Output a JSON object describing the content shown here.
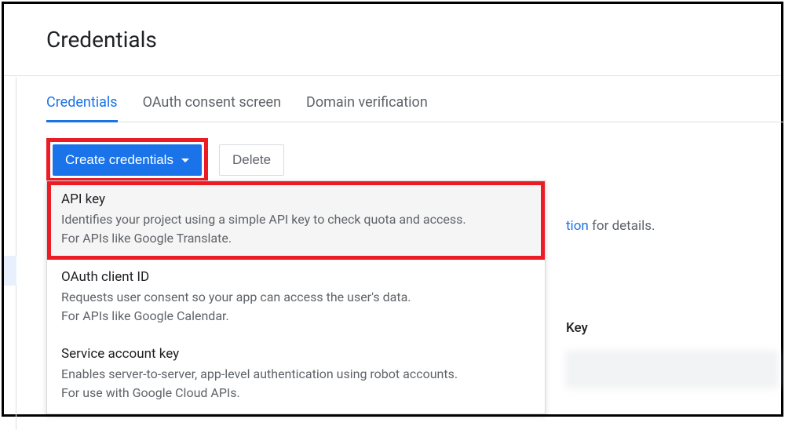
{
  "header": {
    "title": "Credentials"
  },
  "tabs": {
    "items": [
      {
        "label": "Credentials",
        "active": true
      },
      {
        "label": "OAuth consent screen",
        "active": false
      },
      {
        "label": "Domain verification",
        "active": false
      }
    ]
  },
  "toolbar": {
    "create_label": "Create credentials",
    "delete_label": "Delete"
  },
  "dropdown": {
    "items": [
      {
        "title": "API key",
        "desc_line1": "Identifies your project using a simple API key to check quota and access.",
        "desc_line2": "For APIs like Google Translate."
      },
      {
        "title": "OAuth client ID",
        "desc_line1": "Requests user consent so your app can access the user's data.",
        "desc_line2": "For APIs like Google Calendar."
      },
      {
        "title": "Service account key",
        "desc_line1": "Enables server-to-server, app-level authentication using robot accounts.",
        "desc_line2": "For use with Google Cloud APIs."
      }
    ]
  },
  "background": {
    "link_fragment": "tion",
    "text_fragment": " for details.",
    "key_header": "Key"
  }
}
